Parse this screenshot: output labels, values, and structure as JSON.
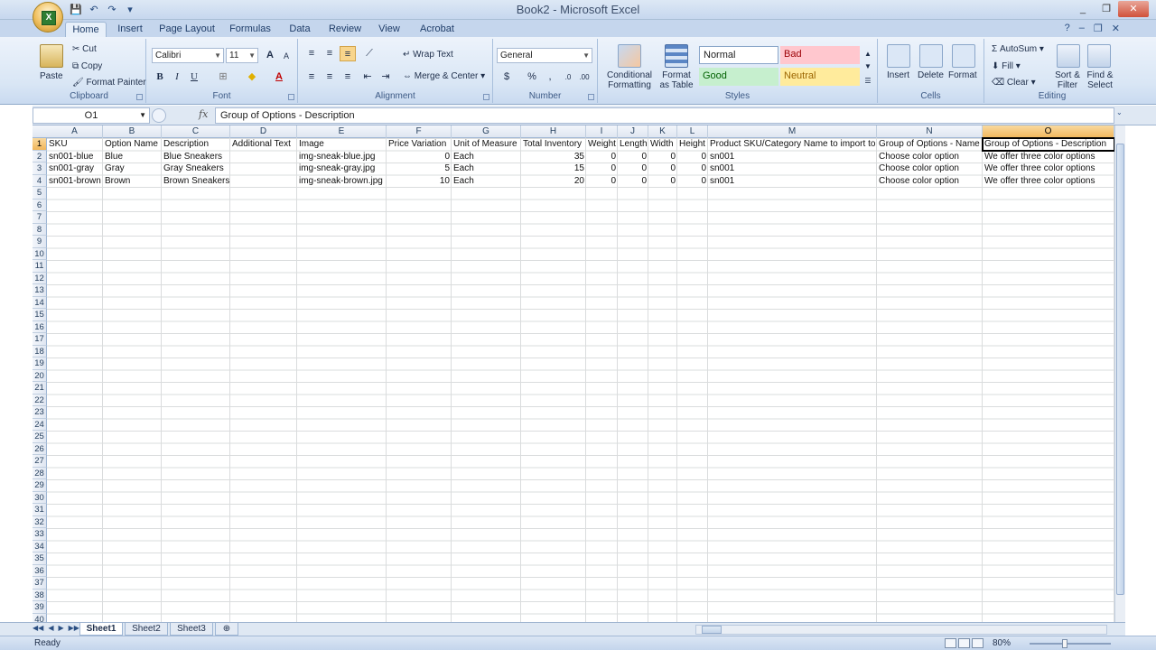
{
  "window": {
    "title": "Book2 - Microsoft Excel",
    "minimize": "_",
    "restore": "❐",
    "close": "✕"
  },
  "qat": {
    "save": "💾",
    "undo": "↶",
    "redo": "↷",
    "customize": "▾"
  },
  "ribbon_tabs": [
    "Home",
    "Insert",
    "Page Layout",
    "Formulas",
    "Data",
    "Review",
    "View",
    "Acrobat"
  ],
  "clipboard": {
    "label": "Clipboard",
    "paste": "Paste",
    "cut": "Cut",
    "copy": "Copy",
    "format_painter": "Format Painter"
  },
  "font": {
    "label": "Font",
    "family": "Calibri",
    "size": "11",
    "bold": "B",
    "italic": "I",
    "underline": "U",
    "grow": "A",
    "shrink": "A"
  },
  "alignment": {
    "label": "Alignment",
    "wrap": "Wrap Text",
    "merge": "Merge & Center"
  },
  "number": {
    "label": "Number",
    "format": "General",
    "currency": "$",
    "percent": "%",
    "comma": ","
  },
  "styles": {
    "label": "Styles",
    "conditional": "Conditional Formatting",
    "format_table": "Format as Table",
    "normal": "Normal",
    "bad": "Bad",
    "good": "Good",
    "neutral": "Neutral"
  },
  "cells_group": {
    "label": "Cells",
    "insert": "Insert",
    "delete": "Delete",
    "format": "Format"
  },
  "editing": {
    "label": "Editing",
    "autosum": "AutoSum",
    "fill": "Fill",
    "clear": "Clear",
    "sort": "Sort & Filter",
    "find": "Find & Select"
  },
  "formula_bar": {
    "name_box": "O1",
    "fx": "fx",
    "content": "Group of Options - Description"
  },
  "columns": [
    "A",
    "B",
    "C",
    "D",
    "E",
    "F",
    "G",
    "H",
    "I",
    "J",
    "K",
    "L",
    "M",
    "N",
    "O"
  ],
  "rows_count": 40,
  "cells": {
    "headers": [
      "SKU",
      "Option Name",
      "Description",
      "Additional Text",
      "Image",
      "Price Variation",
      "Unit of Measure",
      "Total Inventory",
      "Weight",
      "Length",
      "Width",
      "Height",
      "Product SKU/Category Name to import to",
      "Group of Options - Name",
      "Group of Options - Description"
    ],
    "data": [
      [
        "sn001-blue",
        "Blue",
        "Blue Sneakers",
        "",
        "img-sneak-blue.jpg",
        "0",
        "Each",
        "35",
        "0",
        "0",
        "0",
        "0",
        "sn001",
        "Choose color option",
        "We offer three color options"
      ],
      [
        "sn001-gray",
        "Gray",
        "Gray Sneakers",
        "",
        "img-sneak-gray.jpg",
        "5",
        "Each",
        "15",
        "0",
        "0",
        "0",
        "0",
        "sn001",
        "Choose color option",
        "We offer three color options"
      ],
      [
        "sn001-brown",
        "Brown",
        "Brown Sneakers",
        "",
        "img-sneak-brown.jpg",
        "10",
        "Each",
        "20",
        "0",
        "0",
        "0",
        "0",
        "sn001",
        "Choose color option",
        "We offer three color options"
      ]
    ]
  },
  "sheets": [
    "Sheet1",
    "Sheet2",
    "Sheet3"
  ],
  "status": {
    "ready": "Ready",
    "zoom": "80%"
  }
}
